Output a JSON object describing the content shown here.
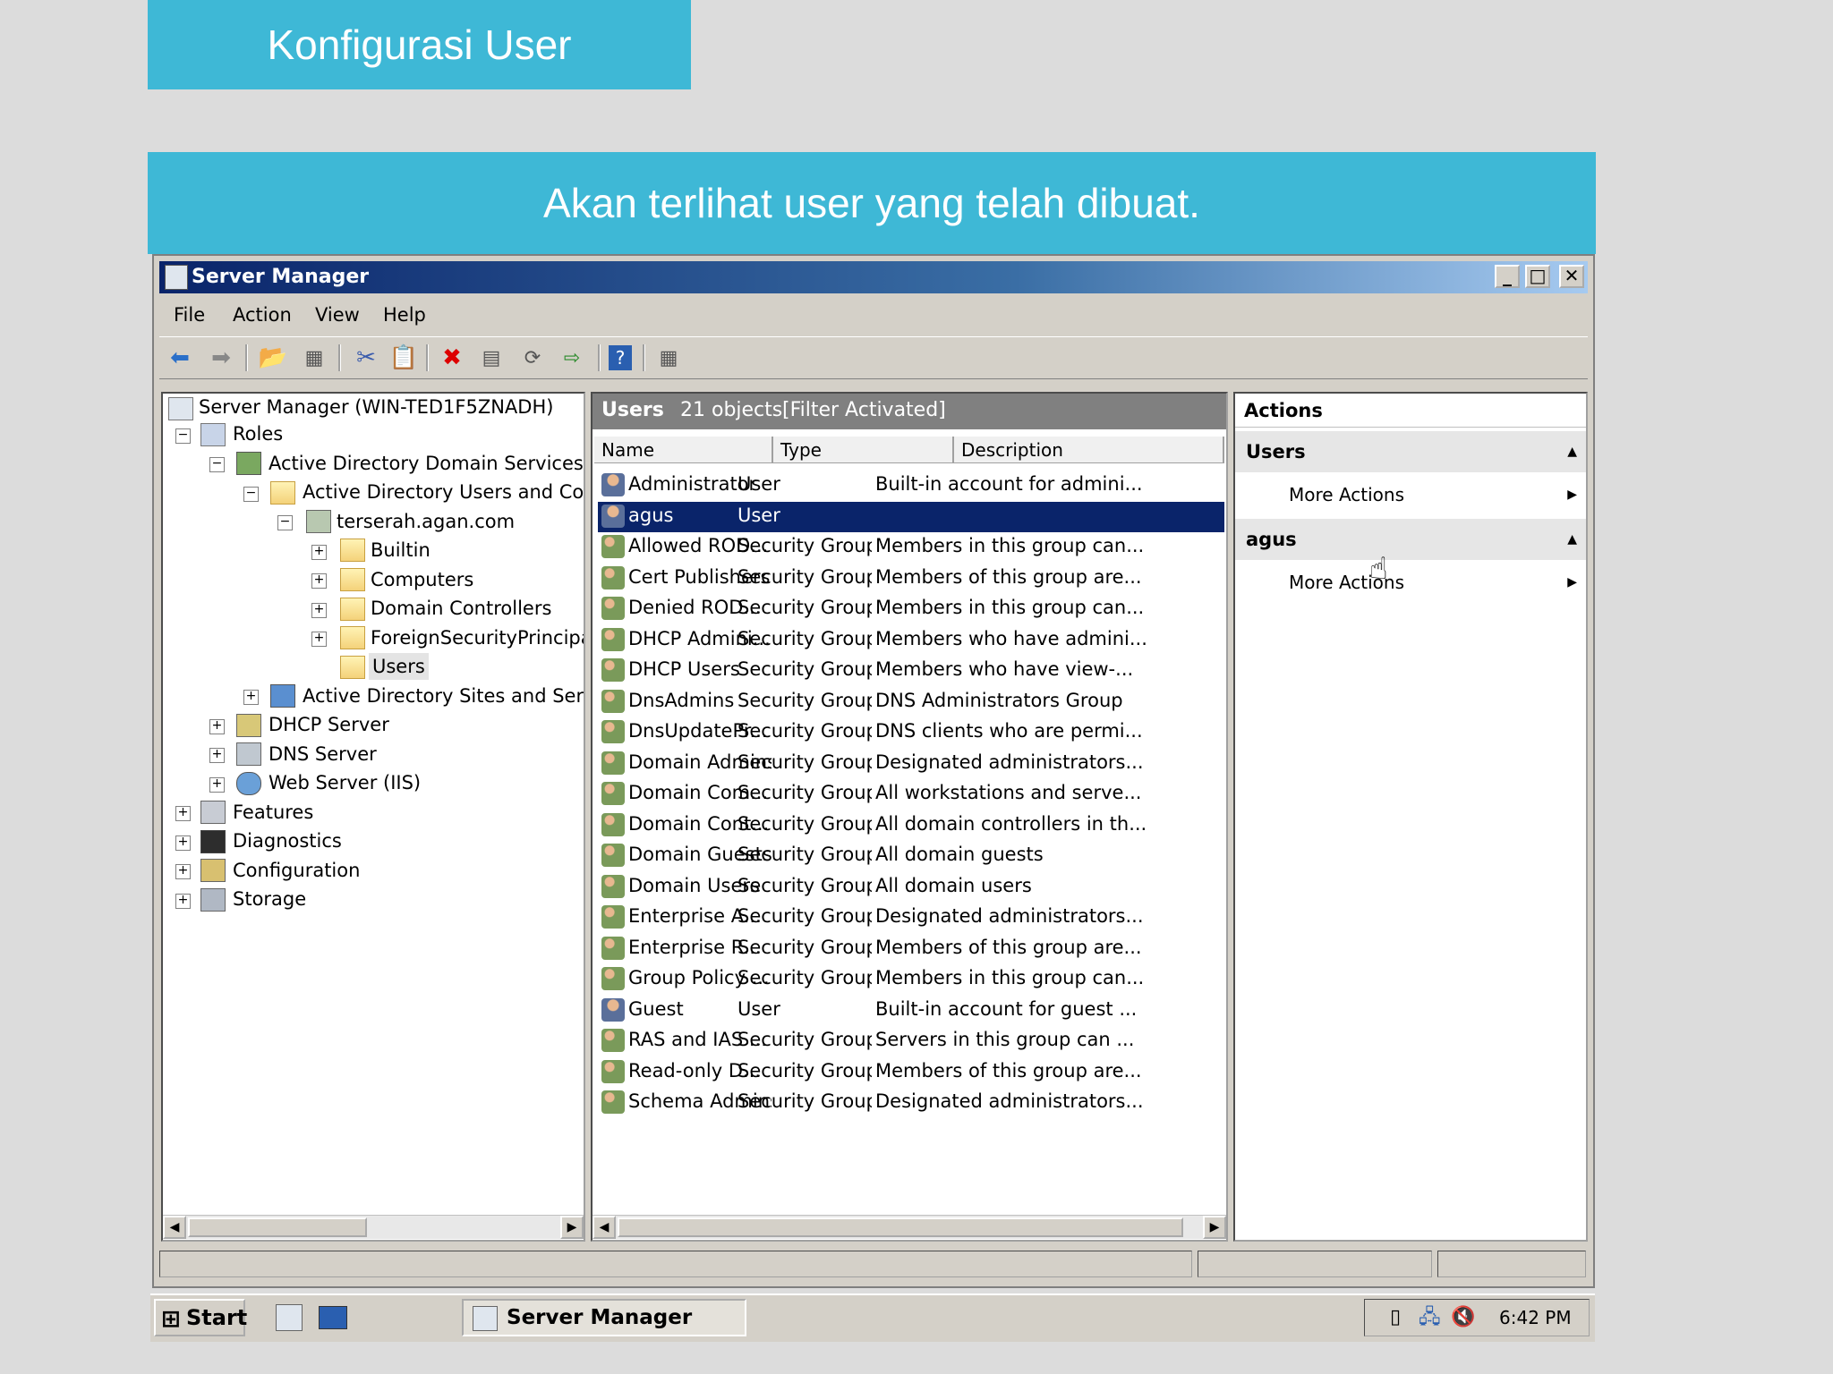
{
  "slide": {
    "title": "Konfigurasi User",
    "subtitle": "Akan terlihat user yang telah dibuat."
  },
  "window": {
    "title": "Server Manager",
    "buttons": {
      "minimize": "_",
      "maximize": "□",
      "close": "✕"
    }
  },
  "menu": [
    "File",
    "Action",
    "View",
    "Help"
  ],
  "tree": {
    "root": "Server Manager (WIN-TED1F5ZNADH)",
    "roles": "Roles",
    "adds": "Active Directory Domain Services",
    "aduc": "Active Directory Users and Com",
    "domain": "terserah.agan.com",
    "builtin": "Builtin",
    "computers": "Computers",
    "dcs": "Domain Controllers",
    "fsp": "ForeignSecurityPrincipal",
    "users": "Users",
    "sites": "Active Directory Sites and Servi",
    "dhcp": "DHCP Server",
    "dns": "DNS Server",
    "web": "Web Server (IIS)",
    "features": "Features",
    "diagnostics": "Diagnostics",
    "configuration": "Configuration",
    "storage": "Storage"
  },
  "list": {
    "title": "Users",
    "count": "21 objects",
    "filter": "[Filter Activated]",
    "columns": [
      "Name",
      "Type",
      "Description"
    ],
    "rows": [
      {
        "name": "Administrator",
        "type": "User",
        "desc": "Built-in account for admini...",
        "kind": "user"
      },
      {
        "name": "agus",
        "type": "User",
        "desc": "",
        "kind": "user",
        "selected": true
      },
      {
        "name": "Allowed ROD...",
        "type": "Security Group ...",
        "desc": "Members in this group can...",
        "kind": "group"
      },
      {
        "name": "Cert Publishers",
        "type": "Security Group ...",
        "desc": "Members of this group are...",
        "kind": "group"
      },
      {
        "name": "Denied ROD...",
        "type": "Security Group ...",
        "desc": "Members in this group can...",
        "kind": "group"
      },
      {
        "name": "DHCP Admini...",
        "type": "Security Group ...",
        "desc": "Members who have admini...",
        "kind": "group"
      },
      {
        "name": "DHCP Users",
        "type": "Security Group ...",
        "desc": "Members who have view-...",
        "kind": "group"
      },
      {
        "name": "DnsAdmins",
        "type": "Security Group ...",
        "desc": "DNS Administrators Group",
        "kind": "group"
      },
      {
        "name": "DnsUpdatePr...",
        "type": "Security Group ...",
        "desc": "DNS clients who are permi...",
        "kind": "group"
      },
      {
        "name": "Domain Admins",
        "type": "Security Group ...",
        "desc": "Designated administrators...",
        "kind": "group"
      },
      {
        "name": "Domain Com...",
        "type": "Security Group ...",
        "desc": "All workstations and serve...",
        "kind": "group"
      },
      {
        "name": "Domain Cont...",
        "type": "Security Group ...",
        "desc": "All domain controllers in th...",
        "kind": "group"
      },
      {
        "name": "Domain Guests",
        "type": "Security Group ...",
        "desc": "All domain guests",
        "kind": "group"
      },
      {
        "name": "Domain Users",
        "type": "Security Group ...",
        "desc": "All domain users",
        "kind": "group"
      },
      {
        "name": "Enterprise A...",
        "type": "Security Group ...",
        "desc": "Designated administrators...",
        "kind": "group"
      },
      {
        "name": "Enterprise R...",
        "type": "Security Group ...",
        "desc": "Members of this group are...",
        "kind": "group"
      },
      {
        "name": "Group Policy ...",
        "type": "Security Group ...",
        "desc": "Members in this group can...",
        "kind": "group"
      },
      {
        "name": "Guest",
        "type": "User",
        "desc": "Built-in account for guest ...",
        "kind": "user"
      },
      {
        "name": "RAS and IAS ...",
        "type": "Security Group ...",
        "desc": "Servers in this group can ...",
        "kind": "group"
      },
      {
        "name": "Read-only D...",
        "type": "Security Group ...",
        "desc": "Members of this group are...",
        "kind": "group"
      },
      {
        "name": "Schema Admins",
        "type": "Security Group ...",
        "desc": "Designated administrators...",
        "kind": "group"
      }
    ]
  },
  "actions": {
    "title": "Actions",
    "sections": [
      {
        "label": "Users",
        "item": "More Actions"
      },
      {
        "label": "agus",
        "item": "More Actions"
      }
    ]
  },
  "taskbar": {
    "start": "Start",
    "task": "Server Manager",
    "clock": "6:42 PM"
  },
  "colors": {
    "accent": "#3eb8d6",
    "selection": "#0a246a",
    "pane_header": "#808080"
  }
}
